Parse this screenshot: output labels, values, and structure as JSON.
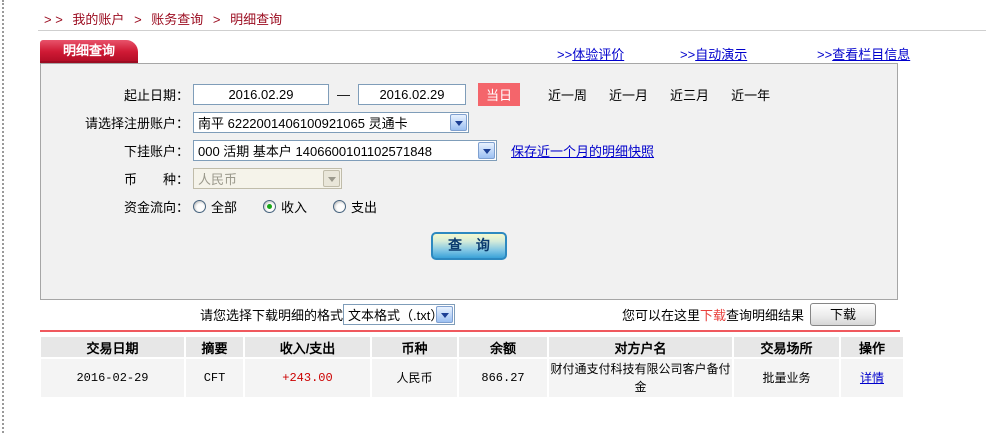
{
  "breadcrumb": {
    "prefix": "> >",
    "sep": ">",
    "items": [
      "我的账户",
      "账务查询",
      "明细查询"
    ]
  },
  "tab": {
    "label": "明细查询"
  },
  "top_links": {
    "experience": {
      "prefix": ">>",
      "label": "体验评价"
    },
    "demo": {
      "prefix": ">>",
      "label": "自动演示"
    },
    "column_info": {
      "prefix": ">>",
      "label": "查看栏目信息"
    }
  },
  "form": {
    "date_range": {
      "label": "起止日期：",
      "start": "2016.02.29",
      "separator": "—",
      "end": "2016.02.29",
      "quick_options": [
        {
          "label": "当日",
          "active": true
        },
        {
          "label": "近一周",
          "active": false
        },
        {
          "label": "近一月",
          "active": false
        },
        {
          "label": "近三月",
          "active": false
        },
        {
          "label": "近一年",
          "active": false
        }
      ]
    },
    "register_account": {
      "label": "请选择注册账户：",
      "value": "南平  6222001406100921065  灵通卡"
    },
    "sub_account": {
      "label": "下挂账户：",
      "value": "000 活期 基本户 1406600101102571848",
      "snapshot_link": "保存近一个月的明细快照"
    },
    "currency": {
      "label": "币　　种：",
      "value": "人民币",
      "disabled": true
    },
    "fund_direction": {
      "label": "资金流向：",
      "options": [
        {
          "label": "全部",
          "checked": false
        },
        {
          "label": "收入",
          "checked": true
        },
        {
          "label": "支出",
          "checked": false
        }
      ]
    },
    "query_button": "查 询"
  },
  "download": {
    "format_label": "请您选择下载明细的格式",
    "format_value": "文本格式（.txt）",
    "hint_before": "您可以在这里",
    "hint_link": "下载",
    "hint_after": "查询明细结果",
    "button": "下载"
  },
  "table": {
    "headers": [
      "交易日期",
      "摘要",
      "收入/支出",
      "币种",
      "余额",
      "对方户名",
      "交易场所",
      "操作"
    ],
    "rows": [
      {
        "date": "2016-02-29",
        "summary": "CFT",
        "amount": "+243.00",
        "currency": "人民币",
        "balance": "866.27",
        "counterparty": "财付通支付科技有限公司客户备付金",
        "place": "批量业务",
        "action": "详情"
      }
    ]
  },
  "colors": {
    "tab_red": "#c01330",
    "badge_red": "#f4656b",
    "rule_red": "#f0595e",
    "breadcrumb_red": "#9a0a1e",
    "link_blue": "#0000cc",
    "amount_red": "#cc0000",
    "panel_gray": "#f1f1f1"
  }
}
